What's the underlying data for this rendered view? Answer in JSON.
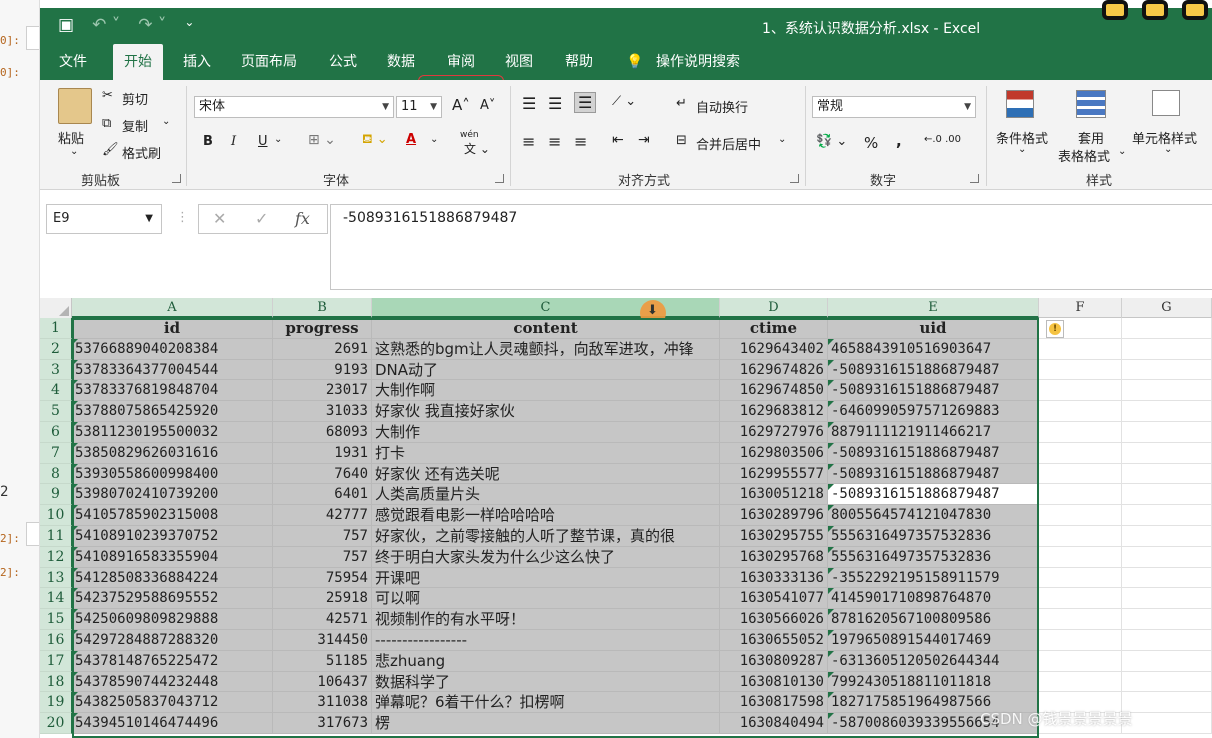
{
  "left_strip": {
    "labels": [
      "0]:",
      "0]:",
      "2",
      "2]:",
      "2]:"
    ]
  },
  "titlebar": {
    "title": "1、系统认识数据分析.xlsx  -  Excel"
  },
  "tabs": [
    "文件",
    "开始",
    "插入",
    "页面布局",
    "公式",
    "数据",
    "审阅",
    "视图",
    "帮助",
    "操作说明搜索"
  ],
  "ribbon": {
    "clipboard": {
      "paste": "粘贴",
      "cut": "剪切",
      "copy": "复制",
      "format_painter": "格式刷",
      "label": "剪贴板"
    },
    "font": {
      "name": "宋体",
      "size": "11",
      "bold": "B",
      "italic": "I",
      "underline": "U",
      "label": "字体",
      "font_color_glyph": "A",
      "phonetic": "wén"
    },
    "alignment": {
      "wrap": "自动换行",
      "merge": "合并后居中",
      "label": "对齐方式"
    },
    "number": {
      "format": "常规",
      "percent": "%",
      "comma": ",",
      "label": "数字"
    },
    "styles": {
      "conditional": "条件格式",
      "table_line1": "套用",
      "table_line2": "表格格式",
      "cell_styles": "单元格样式",
      "label": "样式"
    }
  },
  "formula_bar": {
    "name_box": "E9",
    "formula": "-5089316151886879487"
  },
  "columns": [
    "A",
    "B",
    "C",
    "D",
    "E",
    "F",
    "G"
  ],
  "headers": [
    "id",
    "progress",
    "content",
    "ctime",
    "uid"
  ],
  "rows": [
    {
      "n": "2",
      "id": "53766889040208384",
      "progress": "2691",
      "content": "这熟悉的bgm让人灵魂颤抖，向敌军进攻，冲锋",
      "ctime": "1629643402",
      "uid": "4658843910516903647"
    },
    {
      "n": "3",
      "id": "53783364377004544",
      "progress": "9193",
      "content": "DNA动了",
      "ctime": "1629674826",
      "uid": "-5089316151886879487"
    },
    {
      "n": "4",
      "id": "53783376819848704",
      "progress": "23017",
      "content": "大制作啊",
      "ctime": "1629674850",
      "uid": "-5089316151886879487"
    },
    {
      "n": "5",
      "id": "53788075865425920",
      "progress": "31033",
      "content": "好家伙 我直接好家伙",
      "ctime": "1629683812",
      "uid": "-6460990597571269883"
    },
    {
      "n": "6",
      "id": "53811230195500032",
      "progress": "68093",
      "content": "大制作",
      "ctime": "1629727976",
      "uid": "8879111121911466217"
    },
    {
      "n": "7",
      "id": "53850829626031616",
      "progress": "1931",
      "content": "打卡",
      "ctime": "1629803506",
      "uid": "-5089316151886879487"
    },
    {
      "n": "8",
      "id": "53930558600998400",
      "progress": "7640",
      "content": "好家伙  还有选关呢",
      "ctime": "1629955577",
      "uid": "-5089316151886879487"
    },
    {
      "n": "9",
      "id": "53980702410739200",
      "progress": "6401",
      "content": "人类高质量片头",
      "ctime": "1630051218",
      "uid": "-5089316151886879487"
    },
    {
      "n": "10",
      "id": "54105785902315008",
      "progress": "42777",
      "content": "感觉跟看电影一样哈哈哈哈",
      "ctime": "1630289796",
      "uid": "8005564574121047830"
    },
    {
      "n": "11",
      "id": "54108910239370752",
      "progress": "757",
      "content": "好家伙，之前零接触的人听了整节课，真的很",
      "ctime": "1630295755",
      "uid": "5556316497357532836"
    },
    {
      "n": "12",
      "id": "54108916583355904",
      "progress": "757",
      "content": "终于明白大家头发为什么少这么快了",
      "ctime": "1630295768",
      "uid": "5556316497357532836"
    },
    {
      "n": "13",
      "id": "54128508336884224",
      "progress": "75954",
      "content": "开课吧",
      "ctime": "1630333136",
      "uid": "-3552292195158911579"
    },
    {
      "n": "14",
      "id": "54237529588695552",
      "progress": "25918",
      "content": "可以啊",
      "ctime": "1630541077",
      "uid": "4145901710898764870"
    },
    {
      "n": "15",
      "id": "54250609809829888",
      "progress": "42571",
      "content": "视频制作的有水平呀！",
      "ctime": "1630566026",
      "uid": "8781620567100809586"
    },
    {
      "n": "16",
      "id": "54297284887288320",
      "progress": "314450",
      "content": "-----------------",
      "ctime": "1630655052",
      "uid": "1979650891544017469"
    },
    {
      "n": "17",
      "id": "54378148765225472",
      "progress": "51185",
      "content": "悲zhuang",
      "ctime": "1630809287",
      "uid": "-6313605120502644344"
    },
    {
      "n": "18",
      "id": "54378590744232448",
      "progress": "106437",
      "content": "数据科学了",
      "ctime": "1630810130",
      "uid": "7992430518811011818"
    },
    {
      "n": "19",
      "id": "54382505837043712",
      "progress": "311038",
      "content": "弹幕呢？6着干什么？扣楞啊",
      "ctime": "1630817598",
      "uid": "1827175851964987566"
    },
    {
      "n": "20",
      "id": "54394510146474496",
      "progress": "317673",
      "content": "楞",
      "ctime": "1630840494",
      "uid": "-5870086039339556654"
    }
  ],
  "watermark": "CSDN @钱景景景景景"
}
